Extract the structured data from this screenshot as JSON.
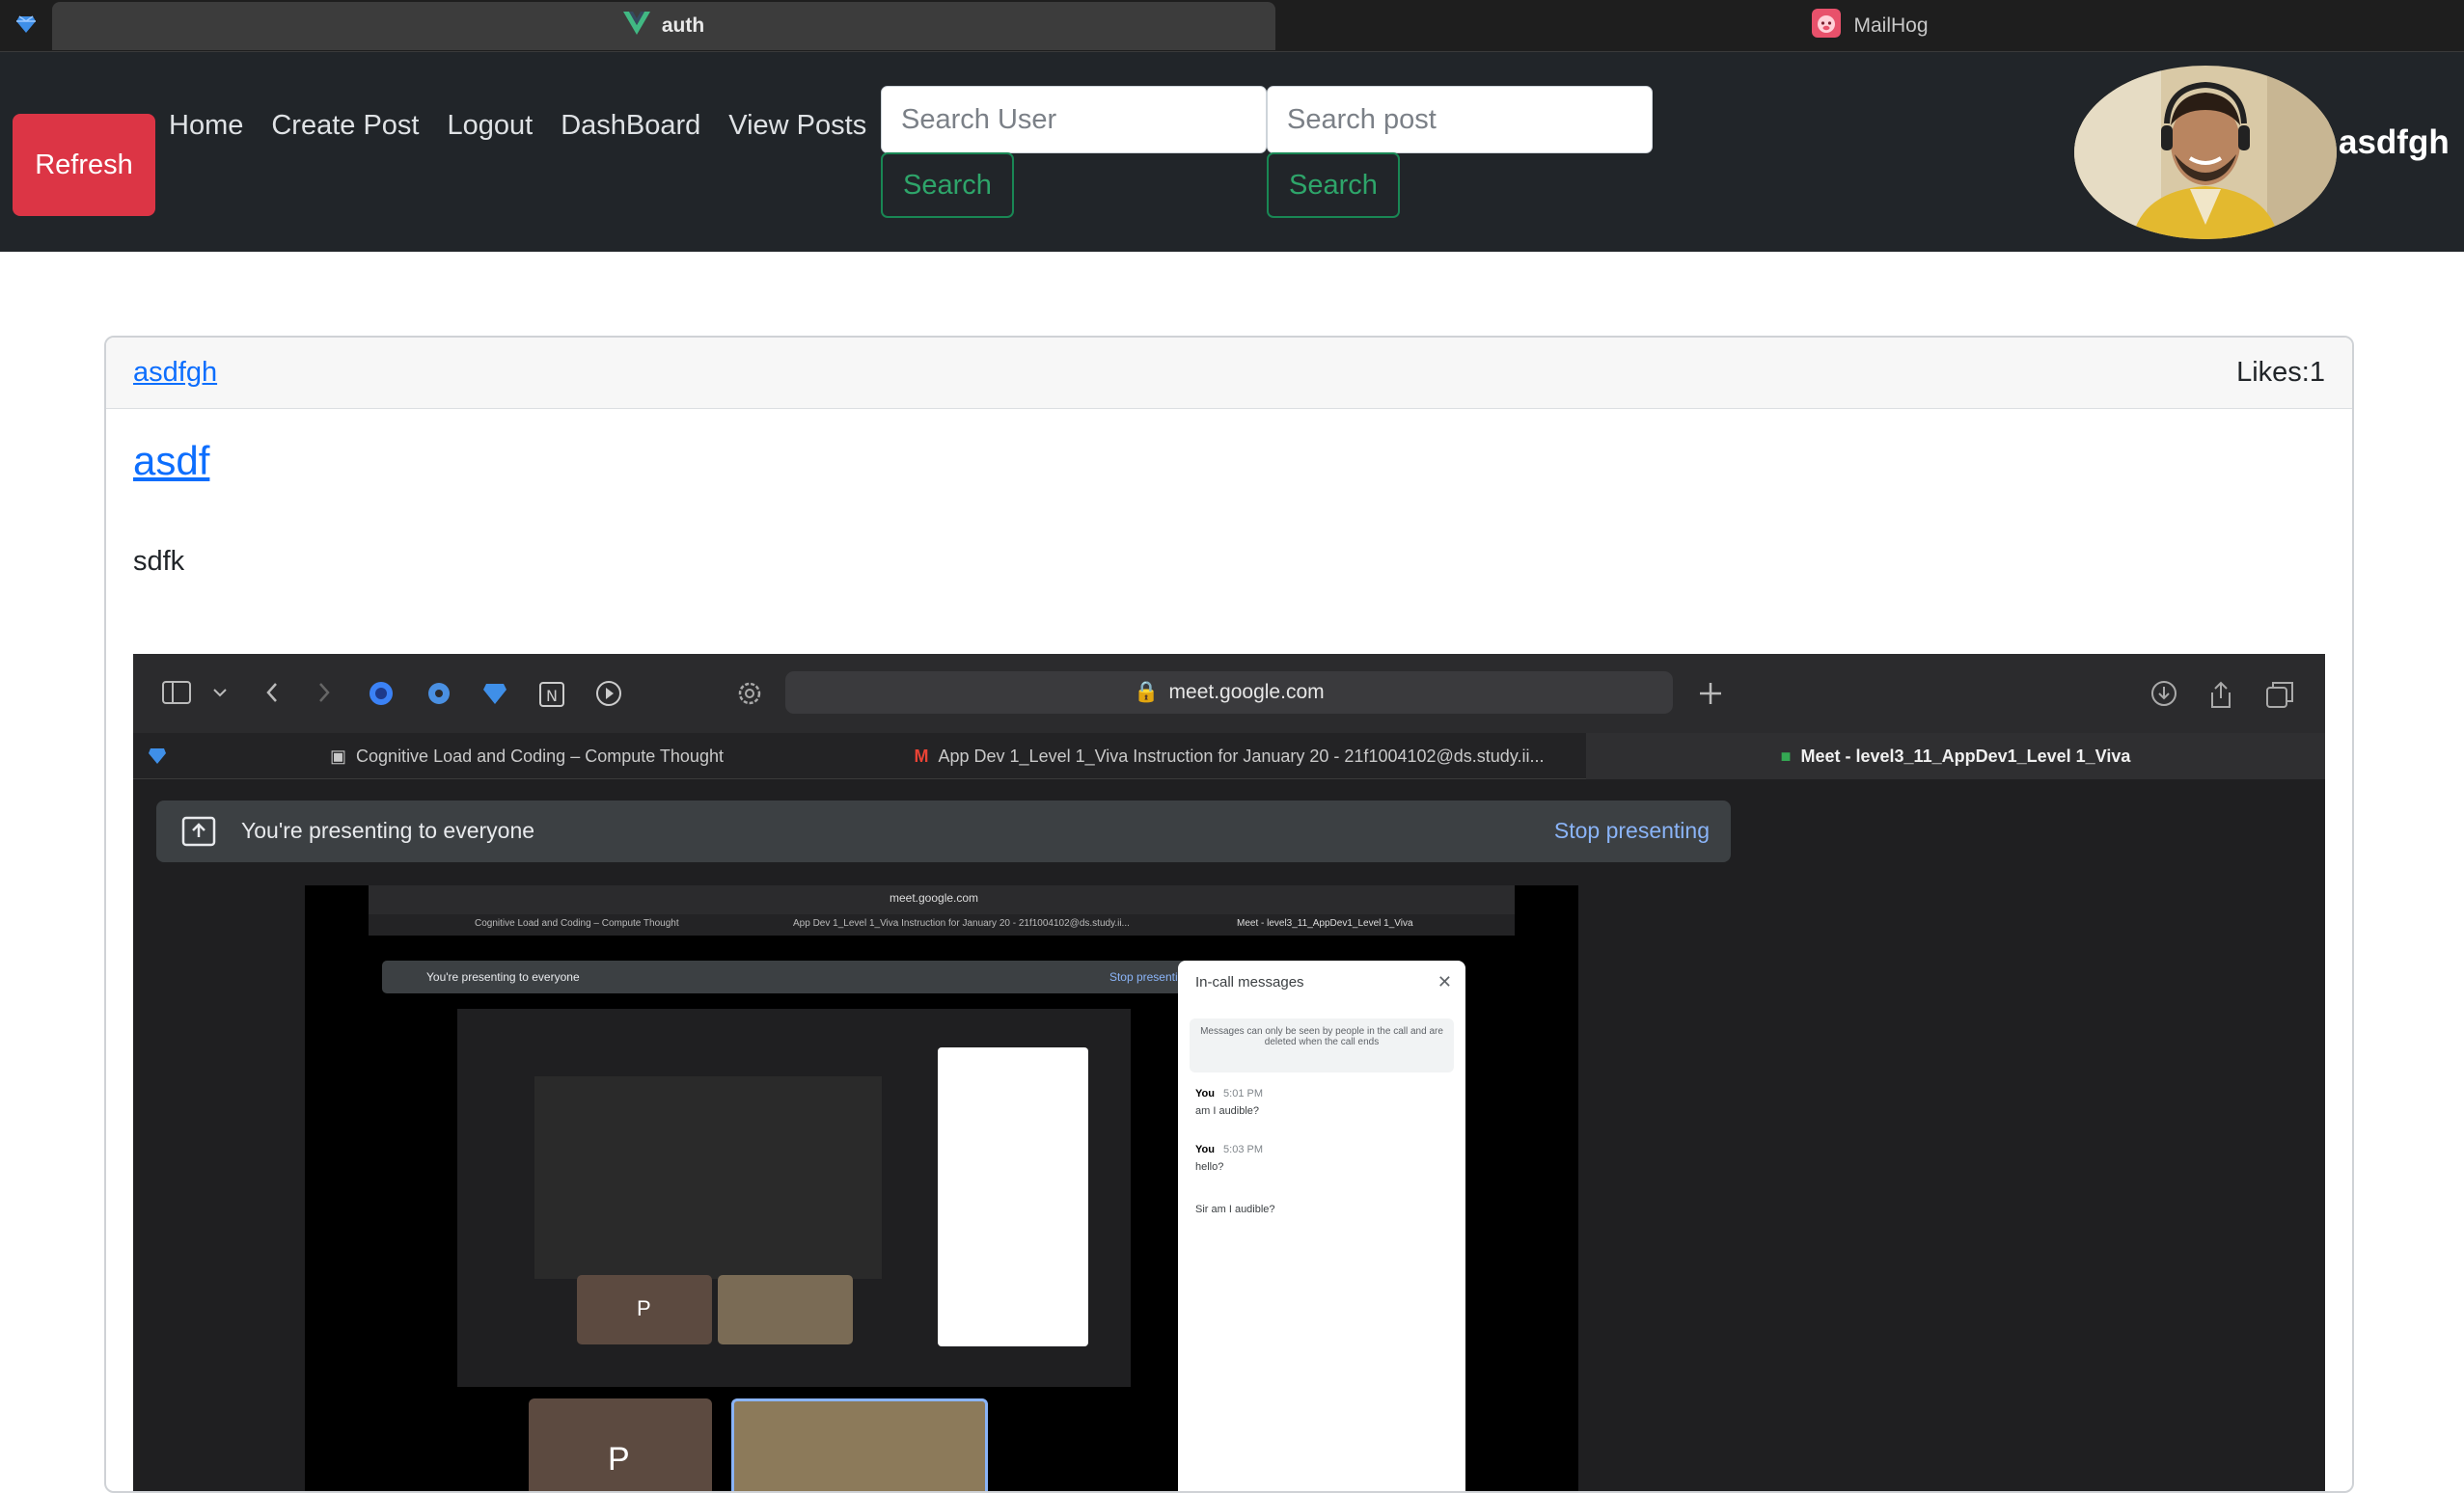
{
  "browser": {
    "tabs": [
      {
        "label": "auth",
        "active": true,
        "icon": "vue-logo-icon"
      },
      {
        "label": "MailHog",
        "active": false,
        "icon": "mailhog-pig-icon"
      }
    ]
  },
  "navbar": {
    "refresh_label": "Refresh",
    "links": [
      "Home",
      "Create Post",
      "Logout",
      "DashBoard",
      "View Posts"
    ],
    "search_user": {
      "placeholder": "Search User",
      "button": "Search"
    },
    "search_post": {
      "placeholder": "Search post",
      "button": "Search"
    },
    "username": "asdfgh",
    "colors": {
      "bg": "#212529",
      "refresh": "#dc3545",
      "search_border": "#198754"
    }
  },
  "post": {
    "author": "asdfgh",
    "likes": "Likes:1",
    "title": "asdf",
    "body": "sdfk",
    "image": {
      "url": "meet.google.com",
      "tabs": [
        "Cognitive Load and Coding – Compute Thought",
        "App Dev 1_Level 1_Viva Instruction for January 20 - 21f1004102@ds.study.ii...",
        "Meet - level3_11_AppDev1_Level 1_Viva"
      ],
      "banner": "You're presenting to everyone",
      "stop_label": "Stop presenting",
      "nested": {
        "url": "meet.google.com",
        "panel_title": "In-call messages",
        "panel_notice": "Messages can only be seen by people in the call and are deleted when the call ends",
        "messages": [
          {
            "sender": "You",
            "time": "5:01 PM",
            "text": "am I audible?"
          },
          {
            "sender": "You",
            "time": "5:03 PM",
            "text": "hello?"
          },
          {
            "sender": "",
            "time": "",
            "text": "Sir am I audible?"
          }
        ],
        "tile_initial": "P"
      }
    }
  }
}
